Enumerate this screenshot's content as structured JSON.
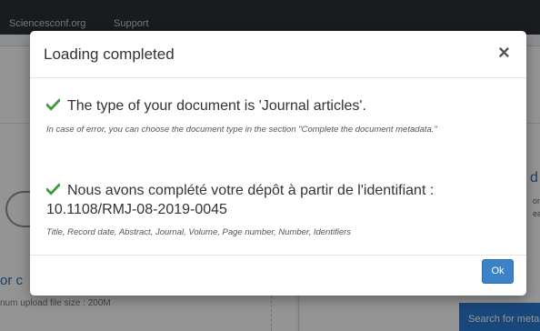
{
  "topbar": {
    "links": [
      "Sciencesconf.org",
      "Support"
    ]
  },
  "background": {
    "title_fragment": "or c",
    "upload_note": "num upload file size : 200M",
    "search_button": "Search for meta",
    "right_fragment": "d",
    "right_small_1": "oms",
    "right_small_2": "ear"
  },
  "modal": {
    "title": "Loading completed",
    "close_glyph": "×",
    "doc_type_message": "The type of your document is 'Journal articles'.",
    "doc_type_note": "In case of error, you can choose the document type in the section \"Complete the document metadata.\"",
    "identifier_message": "Nous avons complété votre dépôt à partir de l'identifiant : 10.1108/RMJ-08-2019-0045",
    "identifier_fields": "Title, Record date, Abstract, Journal, Volume, Page number, Number, Identifiers",
    "ok_label": "Ok"
  },
  "colors": {
    "check": "#3c9a3c",
    "ok_button": "#3b83c9",
    "overlay": "rgba(0,0,0,0.42)"
  },
  "icons": [
    "check-icon",
    "close-icon",
    "cloud-upload-icon"
  ]
}
